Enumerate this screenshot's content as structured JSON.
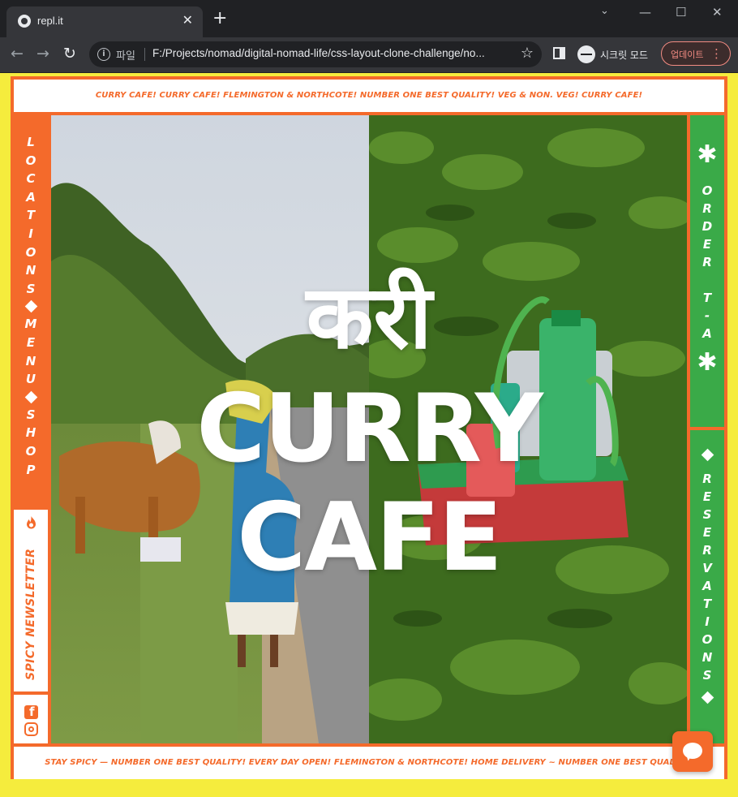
{
  "browser": {
    "tab_title": "repl.it",
    "tab_close": "✕",
    "new_tab": "+",
    "win_min": "—",
    "win_max": "☐",
    "win_close": "✕",
    "back": "←",
    "forward": "→",
    "reload": "↻",
    "info": "i",
    "scheme_label": "파일",
    "url": "F:/Projects/nomad/digital-nomad-life/css-layout-clone-challenge/no...",
    "star": "☆",
    "incognito_label": "시크릿 모드",
    "update_label": "업데이트",
    "kebab": "⋮"
  },
  "page": {
    "top_banner": "CURRY CAFE! CURRY CAFE! FLEMINGTON & NORTHCOTE! NUMBER ONE BEST QUALITY! VEG & NON. VEG! CURRY CAFE!",
    "bottom_banner": "STAY SPICY — NUMBER ONE BEST QUALITY! EVERY DAY OPEN! FLEMINGTON & NORTHCOTE! HOME DELIVERY ~ NUMBER ONE BEST QUALITY!",
    "hero": {
      "title_hindi": "करी",
      "title_line1": "CURRY",
      "title_line2": "CAFE"
    },
    "left_nav": {
      "locations": [
        "L",
        "O",
        "C",
        "A",
        "T",
        "I",
        "O",
        "N",
        "S"
      ],
      "menu": [
        "M",
        "E",
        "N",
        "U"
      ],
      "shop": [
        "S",
        "H",
        "O",
        "P"
      ]
    },
    "newsletter_label": "SPICY NEWSLETTER",
    "right_nav": {
      "order_letters": [
        "O",
        "R",
        "D",
        "E",
        "R"
      ],
      "ta_letters": [
        "T",
        "-",
        "A"
      ],
      "asterisk": "✱",
      "reservations": [
        "R",
        "E",
        "S",
        "E",
        "R",
        "V",
        "A",
        "T",
        "I",
        "O",
        "N",
        "S"
      ]
    },
    "colors": {
      "accent_orange": "#f46a2b",
      "accent_green": "#3aaa48",
      "background_yellow": "#f5ec3d"
    }
  }
}
